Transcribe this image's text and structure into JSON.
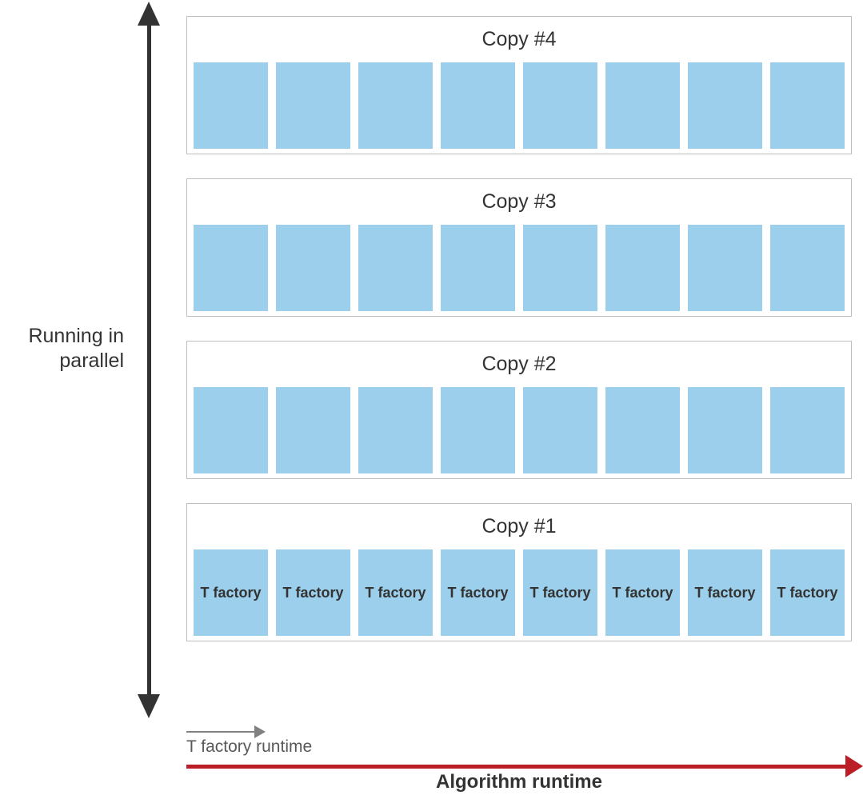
{
  "vertical_axis": {
    "label": "Running in parallel"
  },
  "rows": [
    {
      "title": "Copy #4",
      "blocks": [
        "",
        "",
        "",
        "",
        "",
        "",
        "",
        ""
      ]
    },
    {
      "title": "Copy #3",
      "blocks": [
        "",
        "",
        "",
        "",
        "",
        "",
        "",
        ""
      ]
    },
    {
      "title": "Copy #2",
      "blocks": [
        "",
        "",
        "",
        "",
        "",
        "",
        "",
        ""
      ]
    },
    {
      "title": "Copy #1",
      "blocks": [
        "T factory",
        "T factory",
        "T factory",
        "T factory",
        "T factory",
        "T factory",
        "T factory",
        "T factory"
      ]
    }
  ],
  "t_factory_runtime_label": "T factory runtime",
  "horizontal_axis": {
    "label": "Algorithm runtime"
  },
  "colors": {
    "block_fill": "#9bcfec",
    "axis_dark": "#333333",
    "runtime_red": "#bc1e28",
    "small_arrow": "#808080",
    "row_border": "#bfbfbf"
  },
  "chart_data": {
    "type": "table",
    "description": "Diagram of T factory copies running in parallel over algorithm runtime. 4 copies, 8 T-factory invocations each.",
    "parallel_copies": 4,
    "invocations_per_copy": 8,
    "block_label": "T factory",
    "x_axis": "Algorithm runtime",
    "y_axis": "Running in parallel",
    "block_width_meaning": "T factory runtime"
  }
}
